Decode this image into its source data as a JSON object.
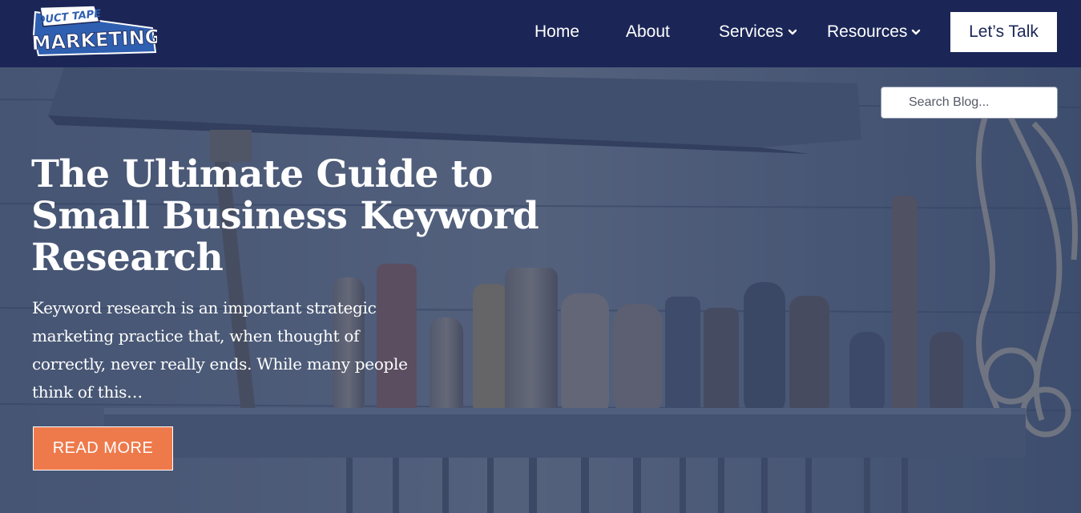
{
  "brand": {
    "logo_line1": "DUCT TAPE",
    "logo_line2": "MARKETING",
    "colors": {
      "header_bg": "#1b2657",
      "accent": "#ee7a4c",
      "logo_blue": "#2f5fb0"
    }
  },
  "nav": {
    "items": [
      {
        "label": "Home",
        "has_dropdown": false
      },
      {
        "label": "About",
        "has_dropdown": false
      },
      {
        "label": "Services",
        "has_dropdown": true,
        "icon": "chevron-down-icon"
      },
      {
        "label": "Resources",
        "has_dropdown": true,
        "icon": "chevron-down-icon"
      }
    ],
    "cta_label": "Let’s Talk"
  },
  "search": {
    "placeholder": "Search Blog...",
    "value": ""
  },
  "hero": {
    "title": "The Ultimate Guide to Small Business Keyword Research",
    "excerpt": "Keyword research is an important strategic marketing practice that, when thought of correctly, never really ends. While many people think of this…",
    "button_label": "READ MORE",
    "background": "workbench-tools-photo"
  }
}
